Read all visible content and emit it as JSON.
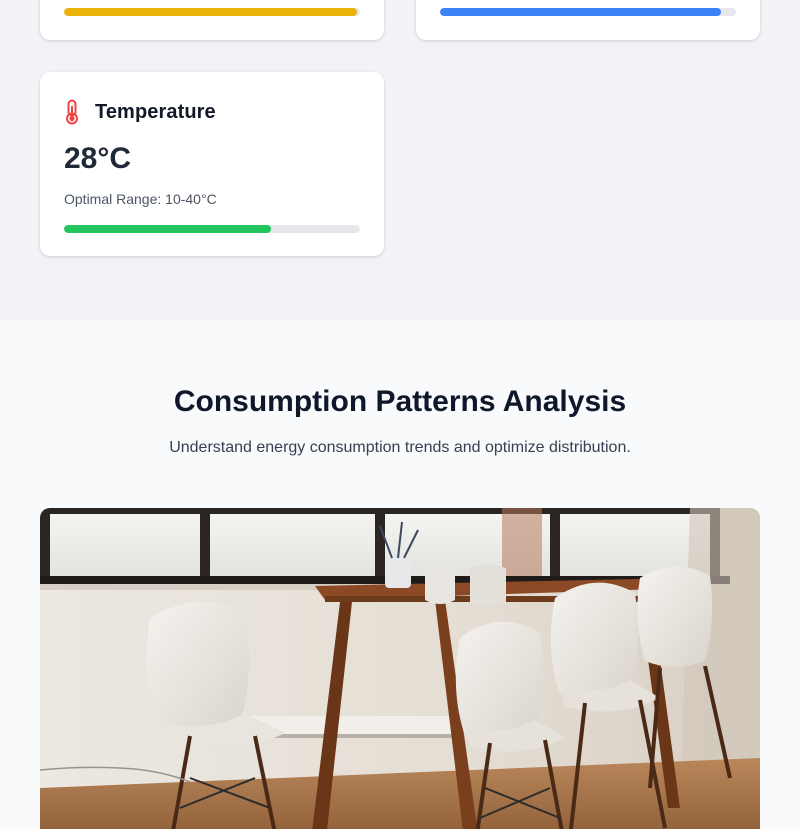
{
  "metrics": {
    "partial_left": {
      "progress_fraction": 0.99,
      "bar_color": "#eab308"
    },
    "partial_right": {
      "progress_fraction": 0.95,
      "bar_color": "#3b82f6"
    },
    "temperature": {
      "title": "Temperature",
      "value": "28°C",
      "range": "Optimal Range: 10-40°C",
      "progress_fraction": 0.7,
      "bar_color": "#22c55e",
      "icon": "thermometer-icon",
      "icon_color": "#ef4444"
    }
  },
  "analysis": {
    "title": "Consumption Patterns Analysis",
    "subtitle": "Understand energy consumption trends and optimize distribution."
  }
}
